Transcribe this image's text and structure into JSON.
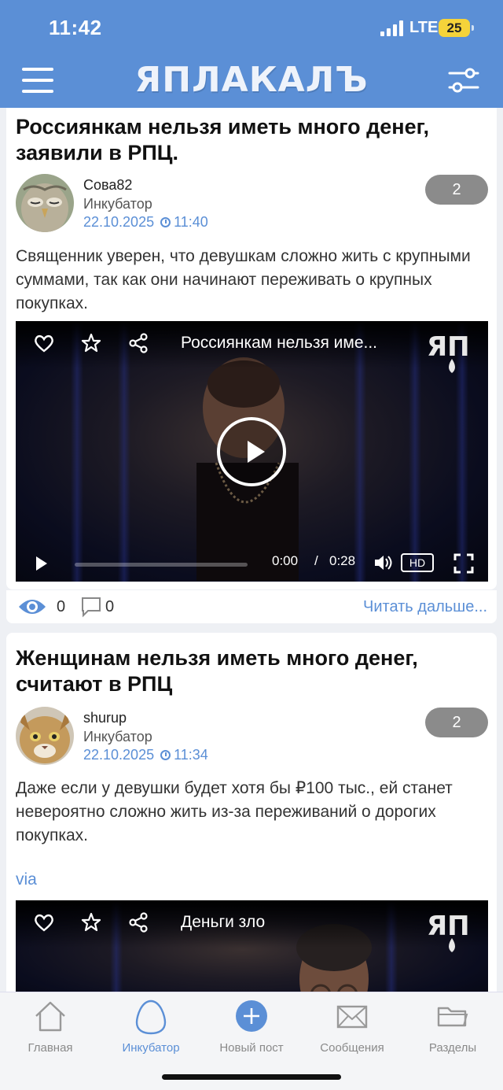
{
  "status_bar": {
    "time": "11:42",
    "network": "LTE",
    "battery": "25"
  },
  "header": {
    "logo": "ЯПЛАКАЛЪ"
  },
  "posts": [
    {
      "title": "Россиянкам нельзя иметь много денег, заявили в РПЦ.",
      "author": "Сова82",
      "section": "Инкубатор",
      "date": "22.10.2025",
      "time": "11:40",
      "rating": "2",
      "text": "Священник уверен, что девушкам сложно жить с крупными суммами, так как они начинают переживать о крупных покупках.",
      "video": {
        "title": "Россиянкам нельзя име...",
        "current_time": "0:00",
        "separator": "/",
        "duration": "0:28",
        "quality": "HD"
      },
      "views": "0",
      "comments": "0",
      "read_more": "Читать дальше..."
    },
    {
      "title": "Женщинам нельзя иметь много денег, считают в РПЦ",
      "author": "shurup",
      "section": "Инкубатор",
      "date": "22.10.2025",
      "time": "11:34",
      "rating": "2",
      "text": "Даже если у девушки будет хотя бы ₽100 тыс., ей станет невероятно сложно жить из-за переживаний о дорогих покупках.",
      "via": "via",
      "video": {
        "title": "Деньги зло"
      }
    }
  ],
  "tabbar": [
    {
      "label": "Главная",
      "icon": "home-icon"
    },
    {
      "label": "Инкубатор",
      "icon": "egg-icon"
    },
    {
      "label": "Новый пост",
      "icon": "plus-icon"
    },
    {
      "label": "Сообщения",
      "icon": "envelope-icon"
    },
    {
      "label": "Разделы",
      "icon": "folder-icon"
    }
  ],
  "colors": {
    "accent": "#5b8fd6",
    "header": "#5b8fd6",
    "rating_badge": "#8b8b8b"
  }
}
